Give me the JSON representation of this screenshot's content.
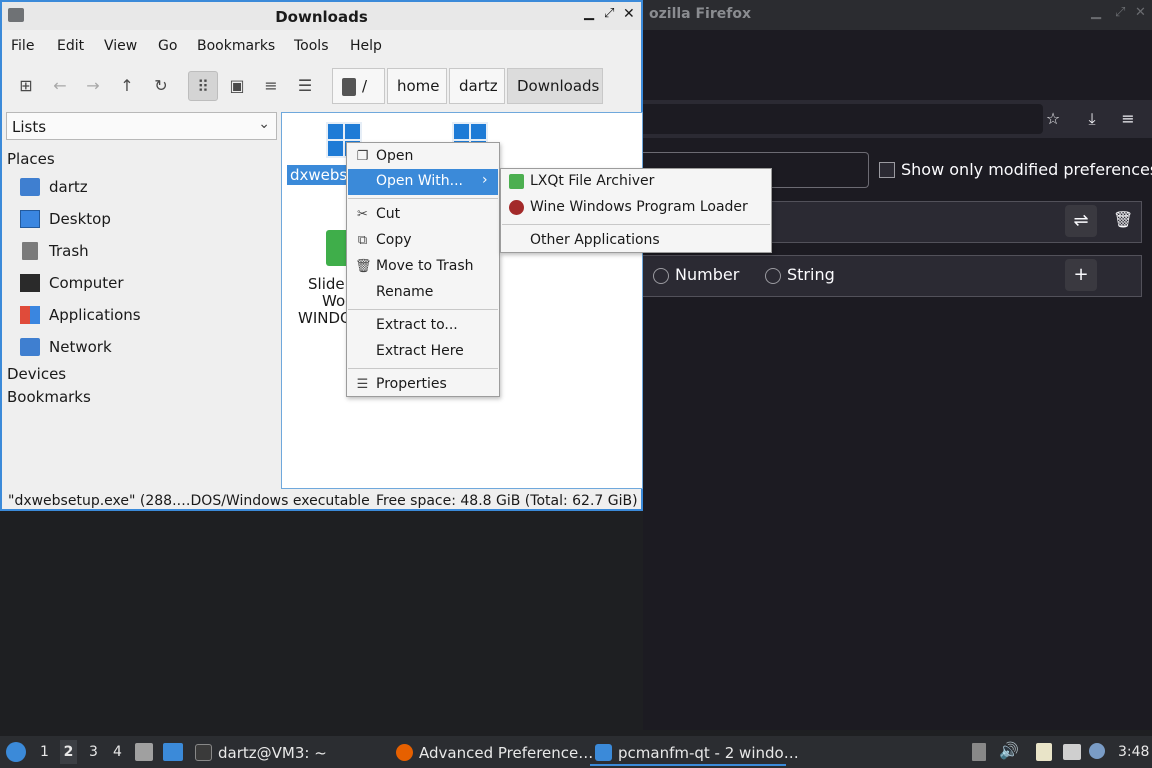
{
  "firefox": {
    "title": "ozilla Firefox",
    "show_modified_label": "Show only modified preferences",
    "radio_number": "Number",
    "radio_string": "String",
    "toolbar_icons": [
      "star-icon",
      "download-icon",
      "menu-icon"
    ]
  },
  "fm": {
    "title": "Downloads",
    "menu": [
      "File",
      "Edit",
      "View",
      "Go",
      "Bookmarks",
      "Tools",
      "Help"
    ],
    "breadcrumb": {
      "root": "/",
      "parts": [
        "home",
        "dartz",
        "Downloads"
      ]
    },
    "side_select": "Lists",
    "places_header": "Places",
    "places": [
      {
        "label": "dartz",
        "icon": "home-folder-icon"
      },
      {
        "label": "Desktop",
        "icon": "desktop-icon"
      },
      {
        "label": "Trash",
        "icon": "trash-icon"
      },
      {
        "label": "Computer",
        "icon": "computer-icon"
      },
      {
        "label": "Applications",
        "icon": "applications-icon"
      },
      {
        "label": "Network",
        "icon": "network-icon"
      }
    ],
    "devices_header": "Devices",
    "bookmarks_header": "Bookmarks",
    "files": [
      {
        "name": "dxwebse",
        "icon": "windows-exe-icon"
      },
      {
        "name": "",
        "icon": "windows-exe-icon"
      },
      {
        "name_lines": [
          "Slide i",
          "Woc",
          "WINDO"
        ],
        "icon": "archive-icon"
      }
    ],
    "status_left": "\"dxwebsetup.exe\" (288.…DOS/Windows executable",
    "status_right": "Free space: 48.8 GiB (Total: 62.7 GiB)"
  },
  "context_menu": {
    "items": [
      "Open",
      "Open With...",
      "Cut",
      "Copy",
      "Move to Trash",
      "Rename",
      "Extract to...",
      "Extract Here",
      "Properties"
    ]
  },
  "submenu": {
    "items": [
      "LXQt File Archiver",
      "Wine Windows Program Loader",
      "Other Applications"
    ]
  },
  "taskbar": {
    "desktops": [
      "1",
      "2",
      "3",
      "4"
    ],
    "tasks": [
      "dartz@VM3: ~",
      "Advanced Preference…",
      "pcmanfm-qt - 2 windo…"
    ],
    "clock": "3:48"
  },
  "colors": {
    "accent": "#3b8ad9",
    "firefox_bg": "#1c1b22",
    "taskbar_bg": "#2b2d31"
  }
}
